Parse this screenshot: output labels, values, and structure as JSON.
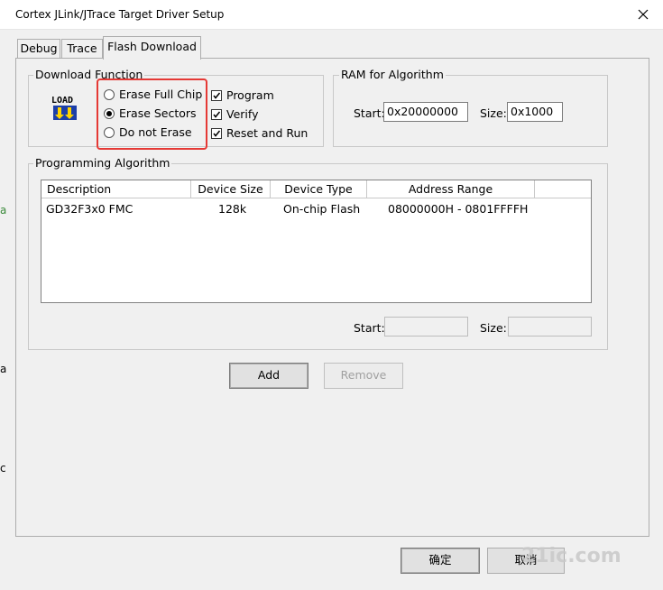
{
  "window": {
    "title": "Cortex JLink/JTrace Target Driver Setup"
  },
  "tabs": [
    {
      "label": "Debug"
    },
    {
      "label": "Trace"
    },
    {
      "label": "Flash Download"
    }
  ],
  "download_function": {
    "title": "Download Function",
    "icon_text": "LOAD",
    "options": [
      {
        "label": "Erase Full Chip",
        "selected": false
      },
      {
        "label": "Erase Sectors",
        "selected": true
      },
      {
        "label": "Do not Erase",
        "selected": false
      }
    ],
    "checks": [
      {
        "label": "Program",
        "checked": true
      },
      {
        "label": "Verify",
        "checked": true
      },
      {
        "label": "Reset and Run",
        "checked": true
      }
    ]
  },
  "ram": {
    "title": "RAM for Algorithm",
    "start_label": "Start:",
    "start_value": "0x20000000",
    "size_label": "Size:",
    "size_value": "0x1000"
  },
  "programming": {
    "title": "Programming Algorithm",
    "columns": [
      "Description",
      "Device Size",
      "Device Type",
      "Address Range"
    ],
    "rows": [
      {
        "description": "GD32F3x0 FMC",
        "size": "128k",
        "type": "On-chip Flash",
        "range": "08000000H - 0801FFFFH"
      }
    ],
    "start_label": "Start:",
    "start_value": "",
    "size_label": "Size:",
    "size_value": ""
  },
  "buttons": {
    "add": "Add",
    "remove": "Remove",
    "ok": "确定",
    "cancel": "取消"
  },
  "edge_fragments": [
    "a",
    "a",
    "c"
  ],
  "watermark": "21ic.com"
}
